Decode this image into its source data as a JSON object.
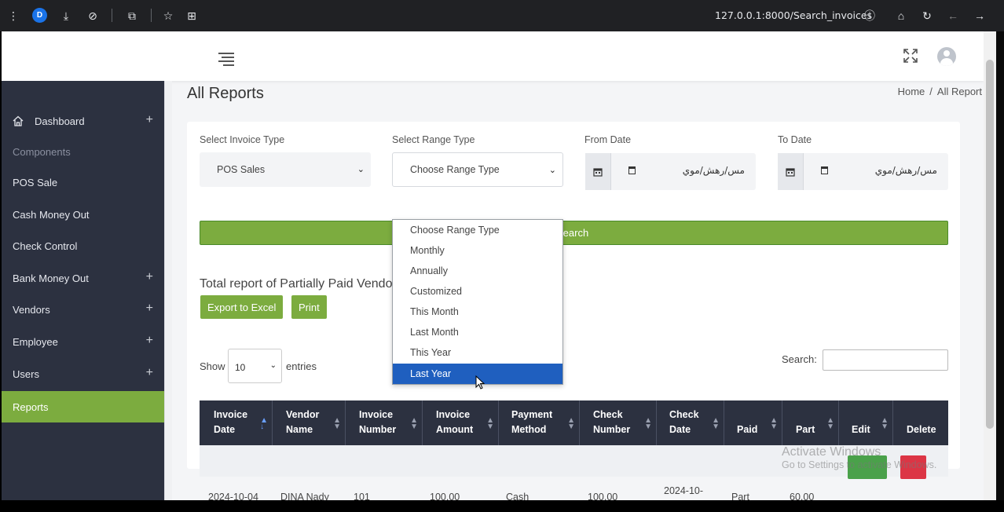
{
  "browser": {
    "profile_initial": "D",
    "url": "127.0.0.1:8000/Search_invoices"
  },
  "sidebar": {
    "items": [
      {
        "label": "Dashboard",
        "has_plus": true
      },
      {
        "label": "Components"
      },
      {
        "label": "POS Sale"
      },
      {
        "label": "Cash Money Out"
      },
      {
        "label": "Check Control"
      },
      {
        "label": "Bank Money Out",
        "has_plus": true
      },
      {
        "label": "Vendors",
        "has_plus": true
      },
      {
        "label": "Employee",
        "has_plus": true
      },
      {
        "label": "Users",
        "has_plus": true
      },
      {
        "label": "Reports",
        "active": true
      }
    ],
    "plus_symbol": "+"
  },
  "page": {
    "title": "All Reports",
    "breadcrumb_home": "Home",
    "breadcrumb_sep": "/",
    "breadcrumb_current": "All Report"
  },
  "filters": {
    "invoice_type_label": "Select Invoice Type",
    "invoice_type_value": "POS Sales",
    "range_type_label": "Select Range Type",
    "range_type_value": "Choose Range Type",
    "from_date_label": "From Date",
    "to_date_label": "To Date",
    "date_placeholder": "مس/رهش/موي",
    "search_button": "Search"
  },
  "range_dropdown": {
    "options": [
      "Choose Range Type",
      "Monthly",
      "Annually",
      "Customized",
      "This Month",
      "Last Month",
      "This Year",
      "Last Year"
    ],
    "highlighted": "Last Year"
  },
  "report": {
    "title": "Total report of Partially Paid Vendors",
    "export_button": "Export to Excel",
    "print_button": "Print",
    "show_label": "Show",
    "entries_value": "10",
    "entries_label": "entries",
    "search_label": "Search:"
  },
  "table": {
    "columns": [
      [
        "Invoice",
        "Date"
      ],
      [
        "Vendor",
        "Name"
      ],
      [
        "Invoice",
        "Number"
      ],
      [
        "Invoice",
        "Amount"
      ],
      [
        "Payment",
        "Method"
      ],
      [
        "Check",
        "Number"
      ],
      [
        "Check",
        "Date"
      ],
      [
        "Paid",
        ""
      ],
      [
        "Part",
        ""
      ],
      [
        "Edit",
        ""
      ],
      [
        "Delete",
        ""
      ]
    ],
    "rows": [
      [
        "2024-10-04",
        "DINA Nady",
        "101",
        "100.00",
        "Cash",
        "100.00",
        "2024-10-",
        "Part",
        "60.00"
      ]
    ]
  },
  "overlay": {
    "activate_line1": "Activate Windows",
    "activate_line2": "Go to Settings to activate Windows."
  },
  "colors": {
    "sidebar_bg": "#2c3140",
    "accent_green": "#7cac3f",
    "dropdown_highlight": "#1f5fbf"
  }
}
